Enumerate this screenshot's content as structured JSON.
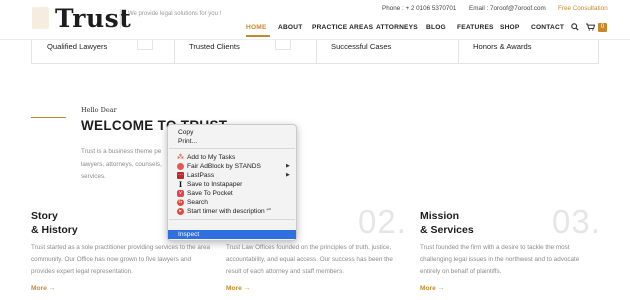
{
  "header": {
    "logo": "Trust",
    "tagline": "We provide legal solutions for you !",
    "phone": "Phone : + 2 0106 5370701",
    "email": "Email : 7oroof@7oroof.com",
    "consultation": "Free Consultation",
    "cart_count": "0"
  },
  "nav": {
    "items": [
      "HOME",
      "ABOUT",
      "PRACTICE AREAS",
      "ATTORNEYS",
      "BLOG",
      "FEATURES",
      "SHOP",
      "CONTACT"
    ],
    "active": "HOME",
    "search_icon": "search-icon",
    "cart_icon": "cart-icon"
  },
  "stats": [
    "Qualified Lawyers",
    "Trusted Clients",
    "Successful Cases",
    "Honors & Awards"
  ],
  "welcome": {
    "hello": "Hello Dear",
    "title": "WELCOME TO TRUST",
    "intro": "Trust is a business theme pe lawyers, attorneys, counsels, services."
  },
  "columns": [
    {
      "title_line1": "Story",
      "title_line2": "& History",
      "number": "",
      "text": "Trust started as a sole practitioner providing services to the area community. Our Office has now grown to five lawyers and provides expert legal representation.",
      "more": "More →"
    },
    {
      "title_line1": "",
      "title_line2": "",
      "number": "02.",
      "text": "Trust Law Offices founded on the principles of truth, justice, accountability, and equal access. Our success has been the result of each attorney and staff members.",
      "more": "More →"
    },
    {
      "title_line1": "Mission",
      "title_line2": "& Services",
      "number": "03.",
      "text": "Trust founded the firm with a desire to tackle the most challenging legal issues in the northwest and to advocate entirely on behalf of plaintiffs.",
      "more": "More →"
    }
  ],
  "context_menu": {
    "items": [
      {
        "label": "Copy",
        "icon": ""
      },
      {
        "label": "Print...",
        "icon": ""
      },
      {
        "label": "Add to My Tasks",
        "icon": "tasks-icon"
      },
      {
        "label": "Fair AdBlock by STANDS",
        "icon": "adblock-icon",
        "submenu": true
      },
      {
        "label": "LastPass",
        "icon": "lastpass-icon",
        "submenu": true
      },
      {
        "label": "Save to Instapaper",
        "icon": "instapaper-icon"
      },
      {
        "label": "Save To Pocket",
        "icon": "pocket-icon"
      },
      {
        "label": "Search",
        "icon": "search-icon"
      },
      {
        "label": "Start timer with description “”",
        "icon": "timer-icon"
      },
      {
        "label": "Inspect",
        "icon": "",
        "selected": true
      }
    ]
  },
  "colors": {
    "accent": "#c8892d",
    "selection": "#2f6fe0"
  }
}
